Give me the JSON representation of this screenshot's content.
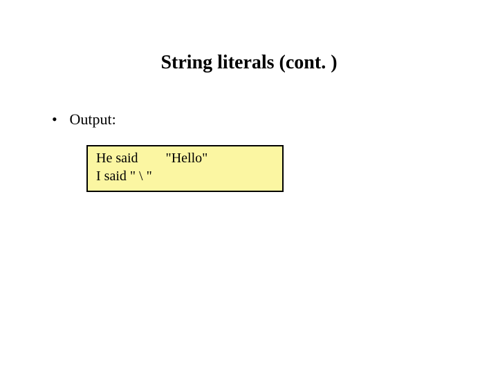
{
  "title": "String literals (cont. )",
  "bullet": {
    "marker": "•",
    "text": "Output:"
  },
  "code": {
    "line1": "He said        \"Hello\"",
    "line2": "I said \" \\ \""
  }
}
